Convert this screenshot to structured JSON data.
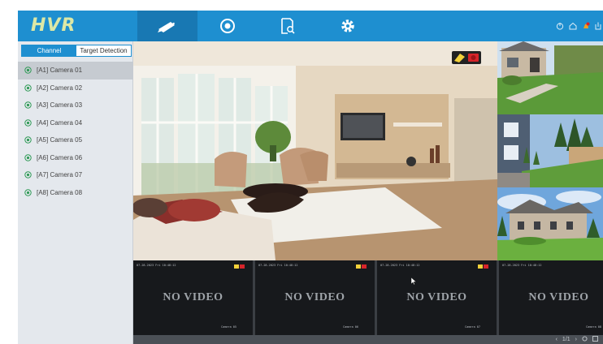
{
  "app": {
    "logo": "HVR"
  },
  "topbar": {
    "tabs": [
      {
        "name": "live-view",
        "active": true
      },
      {
        "name": "playback",
        "active": false
      },
      {
        "name": "search",
        "active": false
      },
      {
        "name": "settings",
        "active": false
      }
    ],
    "right_icons": [
      "power-icon",
      "home-icon",
      "alarm-icon",
      "logout-icon"
    ]
  },
  "sidebar": {
    "tabs": [
      {
        "label": "Channel",
        "active": true
      },
      {
        "label": "Target Detection",
        "active": false
      }
    ],
    "cameras": [
      {
        "label": "[A1] Camera 01",
        "selected": true
      },
      {
        "label": "[A2] Camera 02",
        "selected": false
      },
      {
        "label": "[A3] Camera 03",
        "selected": false
      },
      {
        "label": "[A4] Camera 04",
        "selected": false
      },
      {
        "label": "[A5] Camera 05",
        "selected": false
      },
      {
        "label": "[A6] Camera 06",
        "selected": false
      },
      {
        "label": "[A7] Camera 07",
        "selected": false
      },
      {
        "label": "[A8] Camera 08",
        "selected": false
      }
    ]
  },
  "grid": {
    "no_video_text": "NO VIDEO",
    "cells": [
      {
        "header": "07-28-2023 Fri 10:48:12",
        "footer": "Camera 05"
      },
      {
        "header": "07-28-2023 Fri 10:48:12",
        "footer": "Camera 06"
      },
      {
        "header": "07-28-2023 Fri 10:48:12",
        "footer": "Camera 07"
      },
      {
        "header": "07-28-2023 Fri 10:48:12",
        "footer": "Camera 08"
      }
    ]
  },
  "pager": {
    "prev": "‹",
    "page": "1/1",
    "next": "›"
  },
  "colors": {
    "topbar": "#1e8fd0",
    "active_tab": "#1878b3",
    "logo": "#dce8a6",
    "no_video_bg": "#17191c"
  }
}
